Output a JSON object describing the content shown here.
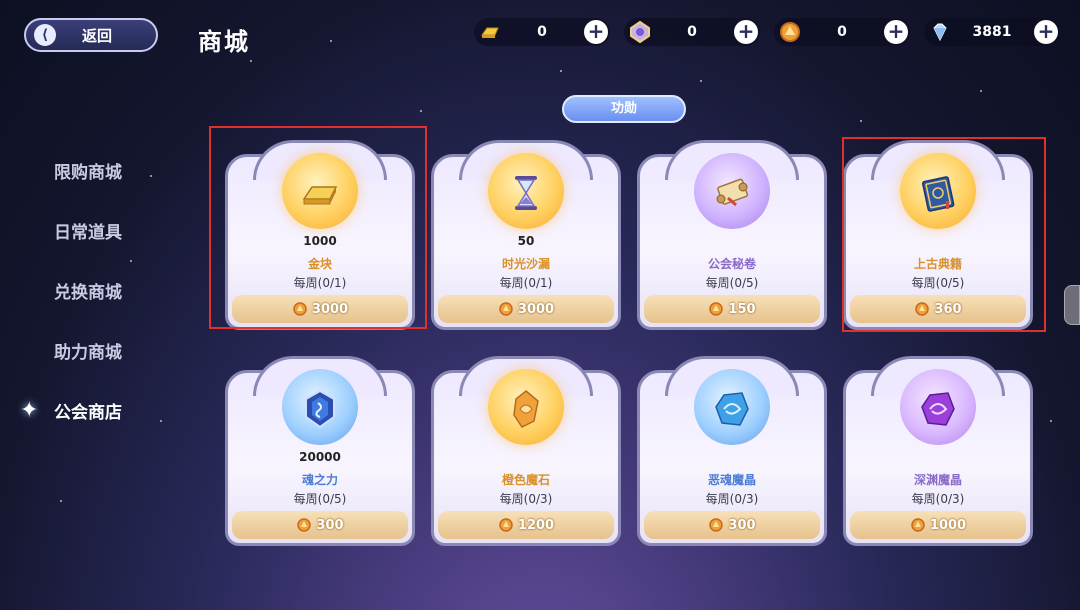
{
  "header": {
    "back_label": "返回",
    "title": "商城"
  },
  "currencies": [
    {
      "icon": "gold-bar-icon",
      "value": "0"
    },
    {
      "icon": "purple-ticket-icon",
      "value": "0"
    },
    {
      "icon": "guild-coin-icon",
      "value": "0"
    },
    {
      "icon": "diamond-icon",
      "value": "3881"
    }
  ],
  "sidebar": {
    "items": [
      {
        "label": "限购商城",
        "active": false
      },
      {
        "label": "日常道具",
        "active": false
      },
      {
        "label": "兑换商城",
        "active": false
      },
      {
        "label": "助力商城",
        "active": false
      },
      {
        "label": "公会商店",
        "active": true
      }
    ]
  },
  "category": {
    "label": "功勋"
  },
  "shop_items": [
    {
      "name": "金块",
      "quantity": "1000",
      "limit": "每周(0/1)",
      "price": "3000",
      "icon": "gold-bar-icon",
      "theme": "gold",
      "name_color": "gold",
      "highlighted": true
    },
    {
      "name": "时光沙漏",
      "quantity": "50",
      "limit": "每周(0/1)",
      "price": "3000",
      "icon": "hourglass-icon",
      "theme": "gold",
      "name_color": "gold",
      "highlighted": false
    },
    {
      "name": "公会秘卷",
      "quantity": "",
      "limit": "每周(0/5)",
      "price": "150",
      "icon": "scroll-icon",
      "theme": "purple",
      "name_color": "purple",
      "highlighted": false
    },
    {
      "name": "上古典籍",
      "quantity": "",
      "limit": "每周(0/5)",
      "price": "360",
      "icon": "ancient-book-icon",
      "theme": "gold",
      "name_color": "gold",
      "highlighted": true
    },
    {
      "name": "魂之力",
      "quantity": "20000",
      "limit": "每周(0/5)",
      "price": "300",
      "icon": "soul-crystal-icon",
      "theme": "blue",
      "name_color": "blue",
      "highlighted": false
    },
    {
      "name": "橙色魔石",
      "quantity": "",
      "limit": "每周(0/3)",
      "price": "1200",
      "icon": "orange-magic-stone-icon",
      "theme": "gold",
      "name_color": "gold",
      "highlighted": false
    },
    {
      "name": "恶魂魔晶",
      "quantity": "",
      "limit": "每周(0/3)",
      "price": "300",
      "icon": "blue-magic-crystal-icon",
      "theme": "blue",
      "name_color": "blue",
      "highlighted": false
    },
    {
      "name": "深渊魔晶",
      "quantity": "",
      "limit": "每周(0/3)",
      "price": "1000",
      "icon": "purple-magic-crystal-icon",
      "theme": "violet",
      "name_color": "purple",
      "highlighted": false
    }
  ],
  "colors": {
    "highlight": "#e0302c",
    "name_gold": "#d9902a",
    "name_blue": "#4a7bd6",
    "name_purple": "#8a6bc8"
  }
}
